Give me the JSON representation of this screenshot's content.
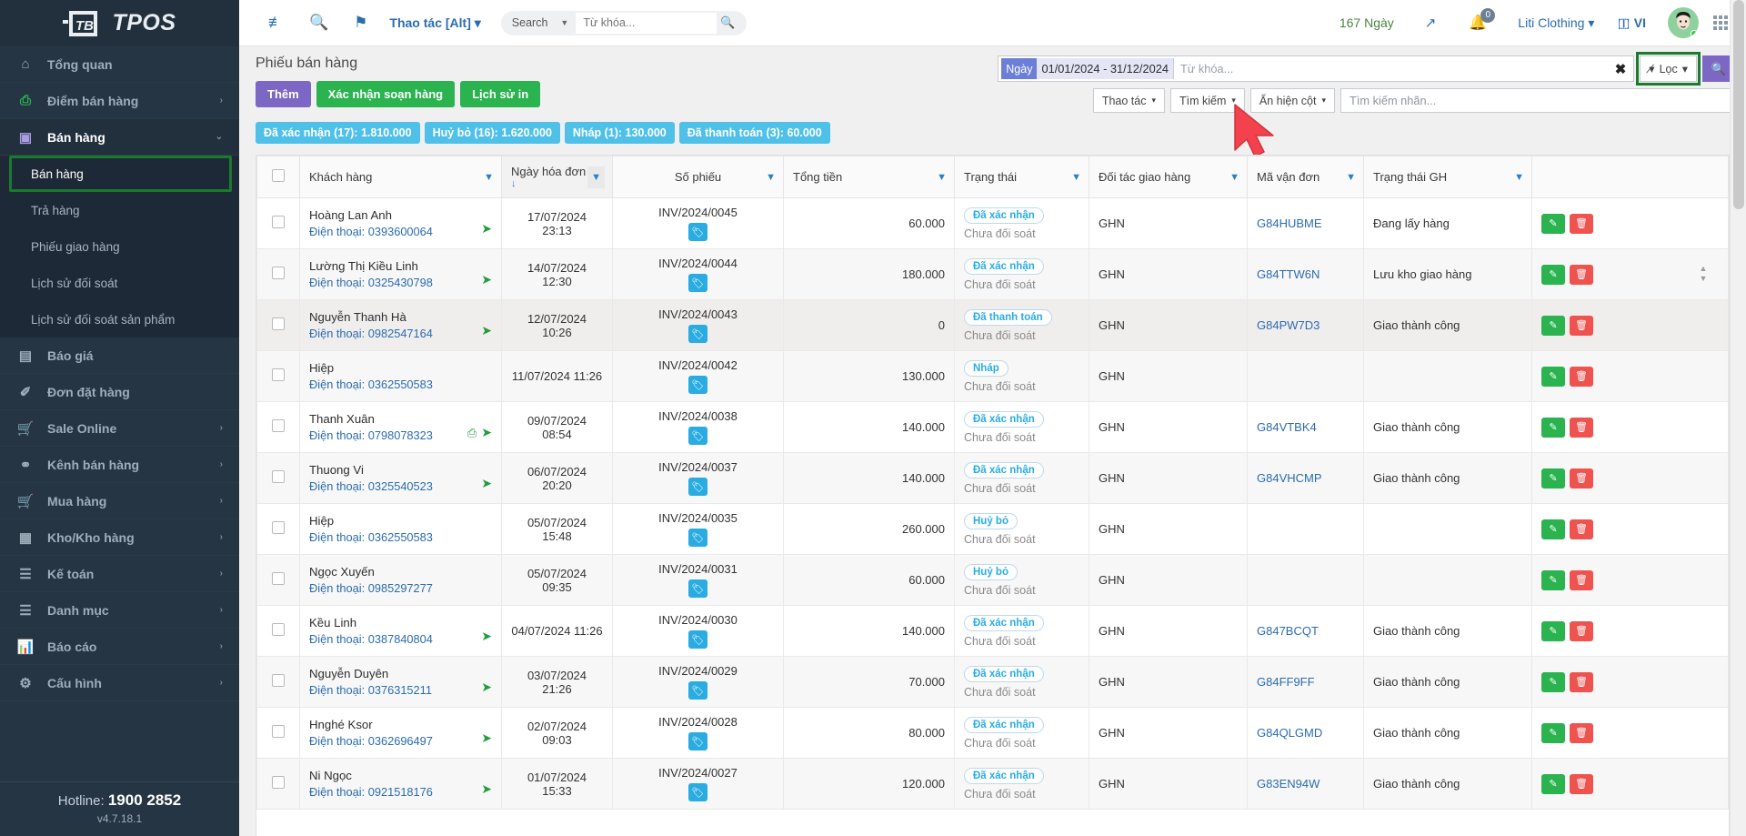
{
  "brand": {
    "name": "TPOS"
  },
  "sidebar": {
    "items": [
      {
        "icon": "home-icon",
        "glyph": "⌂",
        "label": "Tổng quan",
        "arrow": "",
        "active": false
      },
      {
        "icon": "printer-icon",
        "glyph": "⎙",
        "label": "Điểm bán hàng",
        "arrow": "›",
        "active": false
      },
      {
        "icon": "book-icon",
        "glyph": "▣",
        "label": "Bán hàng",
        "arrow": "⌄",
        "active": true
      },
      {
        "icon": "file-icon",
        "glyph": "☰",
        "label": "Báo giá",
        "arrow": "",
        "active": false
      },
      {
        "icon": "orders-icon",
        "glyph": "✐",
        "label": "Đơn đặt hàng",
        "arrow": "",
        "active": false
      },
      {
        "icon": "cart-online-icon",
        "glyph": "Ὥ2",
        "label": "Sale Online",
        "arrow": "›",
        "active": false
      },
      {
        "icon": "link-icon",
        "glyph": "⚭",
        "label": "Kênh bán hàng",
        "arrow": "›",
        "active": false
      },
      {
        "icon": "cart-icon",
        "glyph": "⬒",
        "label": "Mua hàng",
        "arrow": "›",
        "active": false
      },
      {
        "icon": "warehouse-icon",
        "glyph": "☷",
        "label": "Kho/Kho hàng",
        "arrow": "›",
        "active": false
      },
      {
        "icon": "accounting-icon",
        "glyph": "☰",
        "label": "Kế toán",
        "arrow": "›",
        "active": false
      },
      {
        "icon": "catalog-icon",
        "glyph": "☰",
        "label": "Danh mục",
        "arrow": "›",
        "active": false
      },
      {
        "icon": "chart-icon",
        "glyph": "Ὄa",
        "label": "Báo cáo",
        "arrow": "›",
        "active": false
      },
      {
        "icon": "settings-icon",
        "glyph": "⚙",
        "label": "Cấu hình",
        "arrow": "›",
        "active": false
      }
    ],
    "submenu": [
      {
        "label": "Bán hàng",
        "selected": true
      },
      {
        "label": "Trả hàng",
        "selected": false
      },
      {
        "label": "Phiếu giao hàng",
        "selected": false
      },
      {
        "label": "Lịch sử đối soát",
        "selected": false
      },
      {
        "label": "Lịch sử đối soát sản phẩm",
        "selected": false
      }
    ],
    "footer": {
      "hotline_label": "Hotline:",
      "hotline_number": "1900 2852",
      "version": "v4.7.18.1"
    }
  },
  "topbar": {
    "menu_icon": "list-collapse-icon",
    "search_icon": "zoom-out-icon",
    "pin_icon": "pin-icon",
    "action_label": "Thao tác [Alt]",
    "search_select": "Search",
    "search_placeholder": "Từ khóa...",
    "days_left": "167 Ngày",
    "expand_icon": "expand-icon",
    "notifications": "0",
    "company": "Liti Clothing",
    "language": "VI",
    "apps_icon": "apps-grid-icon"
  },
  "page": {
    "title": "Phiếu bán hàng",
    "buttons": [
      {
        "label": "Thêm",
        "style": "purple",
        "name": "add-button"
      },
      {
        "label": "Xác nhận soạn hàng",
        "style": "green",
        "name": "confirm-prepare-button"
      },
      {
        "label": "Lịch sử in",
        "style": "green",
        "name": "print-history-button"
      }
    ],
    "filter": {
      "date_label": "Ngày",
      "date_value": "01/01/2024 - 31/12/2024",
      "keyword_placeholder": "Từ khóa...",
      "clear_label": "✖",
      "filter_label": "Lọc",
      "search_icon": "search-icon"
    },
    "controls": [
      {
        "label": "Thao tác",
        "name": "actions-dropdown"
      },
      {
        "label": "Tìm kiếm",
        "name": "search-dropdown"
      },
      {
        "label": "Ẩn hiện cột",
        "name": "toggle-columns-dropdown"
      }
    ],
    "tag_search_placeholder": "Tìm kiếm nhãn...",
    "chips": [
      {
        "label": "Đã xác nhận (17): 1.810.000",
        "name": "chip-confirmed"
      },
      {
        "label": "Huỷ bỏ (16): 1.620.000",
        "name": "chip-cancelled"
      },
      {
        "label": "Nháp (1): 130.000",
        "name": "chip-draft"
      },
      {
        "label": "Đã thanh toán (3): 60.000",
        "name": "chip-paid"
      }
    ]
  },
  "table": {
    "columns": [
      {
        "key": "check",
        "label": ""
      },
      {
        "key": "customer",
        "label": "Khách hàng"
      },
      {
        "key": "date",
        "label": "Ngày hóa đơn"
      },
      {
        "key": "voucher",
        "label": "Số phiếu"
      },
      {
        "key": "total",
        "label": "Tổng tiền"
      },
      {
        "key": "status",
        "label": "Trạng thái"
      },
      {
        "key": "carrier",
        "label": "Đối tác giao hàng"
      },
      {
        "key": "tracking",
        "label": "Mã vận đơn"
      },
      {
        "key": "ship_status",
        "label": "Trạng thái GH"
      },
      {
        "key": "actions",
        "label": ""
      }
    ],
    "phone_prefix": "Điện thoại:",
    "reconcile_label": "Chưa đối soát",
    "rows": [
      {
        "customer": "Hoàng Lan Anh",
        "phone": "0393600064",
        "print": false,
        "send": true,
        "date": "17/07/2024 23:13",
        "voucher": "INV/2024/0045",
        "total": "60.000",
        "status": "Đã xác nhận",
        "carrier": "GHN",
        "tracking": "G84HUBME",
        "ship_status": "Đang lấy hàng"
      },
      {
        "customer": "Lường Thị Kiều Linh",
        "phone": "0325430798",
        "print": false,
        "send": true,
        "date": "14/07/2024 12:30",
        "voucher": "INV/2024/0044",
        "total": "180.000",
        "status": "Đã xác nhận",
        "carrier": "GHN",
        "tracking": "G84TTW6N",
        "ship_status": "Lưu kho giao hàng"
      },
      {
        "customer": "Nguyễn Thanh Hà",
        "phone": "0982547164",
        "print": false,
        "send": true,
        "date": "12/07/2024 10:26",
        "voucher": "INV/2024/0043",
        "total": "0",
        "status": "Đã thanh toán",
        "carrier": "GHN",
        "tracking": "G84PW7D3",
        "ship_status": "Giao thành công"
      },
      {
        "customer": "Hiệp",
        "phone": "0362550583",
        "print": false,
        "send": false,
        "date": "11/07/2024 11:26",
        "voucher": "INV/2024/0042",
        "total": "130.000",
        "status": "Nháp",
        "carrier": "GHN",
        "tracking": "",
        "ship_status": ""
      },
      {
        "customer": "Thanh Xuân",
        "phone": "0798078323",
        "print": true,
        "send": true,
        "date": "09/07/2024 08:54",
        "voucher": "INV/2024/0038",
        "total": "140.000",
        "status": "Đã xác nhận",
        "carrier": "GHN",
        "tracking": "G84VTBK4",
        "ship_status": "Giao thành công"
      },
      {
        "customer": "Thuong Vi",
        "phone": "0325540523",
        "print": false,
        "send": true,
        "date": "06/07/2024 20:20",
        "voucher": "INV/2024/0037",
        "total": "140.000",
        "status": "Đã xác nhận",
        "carrier": "GHN",
        "tracking": "G84VHCMP",
        "ship_status": "Giao thành công"
      },
      {
        "customer": "Hiệp",
        "phone": "0362550583",
        "print": false,
        "send": false,
        "date": "05/07/2024 15:48",
        "voucher": "INV/2024/0035",
        "total": "260.000",
        "status": "Huỷ bỏ",
        "carrier": "GHN",
        "tracking": "",
        "ship_status": ""
      },
      {
        "customer": "Ngọc Xuyến",
        "phone": "0985297277",
        "print": false,
        "send": false,
        "date": "05/07/2024 09:35",
        "voucher": "INV/2024/0031",
        "total": "60.000",
        "status": "Huỷ bỏ",
        "carrier": "GHN",
        "tracking": "",
        "ship_status": ""
      },
      {
        "customer": "Kều Linh",
        "phone": "0387840804",
        "print": false,
        "send": true,
        "date": "04/07/2024 11:26",
        "voucher": "INV/2024/0030",
        "total": "140.000",
        "status": "Đã xác nhận",
        "carrier": "GHN",
        "tracking": "G847BCQT",
        "ship_status": "Giao thành công"
      },
      {
        "customer": "Nguyễn Duyên",
        "phone": "0376315211",
        "print": false,
        "send": true,
        "date": "03/07/2024 21:26",
        "voucher": "INV/2024/0029",
        "total": "70.000",
        "status": "Đã xác nhận",
        "carrier": "GHN",
        "tracking": "G84FF9FF",
        "ship_status": "Giao thành công"
      },
      {
        "customer": "Hnghé Ksor",
        "phone": "0362696497",
        "print": false,
        "send": true,
        "date": "02/07/2024 09:03",
        "voucher": "INV/2024/0028",
        "total": "80.000",
        "status": "Đã xác nhận",
        "carrier": "GHN",
        "tracking": "G84QLGMD",
        "ship_status": "Giao thành công"
      },
      {
        "customer": "Ni Ngọc",
        "phone": "0921518176",
        "print": false,
        "send": true,
        "date": "01/07/2024 15:33",
        "voucher": "INV/2024/0027",
        "total": "120.000",
        "status": "Đã xác nhận",
        "carrier": "GHN",
        "tracking": "G83EN94W",
        "ship_status": "Giao thành công"
      }
    ]
  },
  "colors": {
    "accent_purple": "#7d67c4",
    "accent_green": "#2ab34f",
    "chip_blue": "#4fc0e8",
    "sidebar_bg": "#263544",
    "highlight_green": "#1a7a2e"
  }
}
